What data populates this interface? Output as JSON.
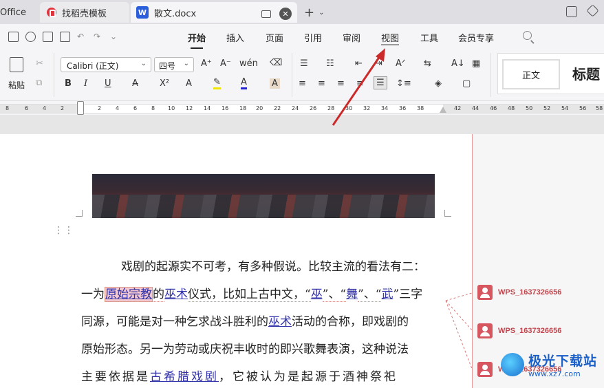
{
  "tabs": {
    "office_label": "Office",
    "docer_label": "找稻壳模板",
    "doc_icon_letter": "W",
    "doc_label": "散文.docx"
  },
  "menu": {
    "items": [
      "开始",
      "插入",
      "页面",
      "引用",
      "审阅",
      "视图",
      "工具",
      "会员专享"
    ],
    "active": "开始"
  },
  "ribbon": {
    "paste_label": "粘贴",
    "font_name": "Calibri (正文)",
    "font_size": "四号",
    "bold": "B",
    "italic": "I",
    "underline": "U",
    "style_normal": "正文",
    "style_title": "标题"
  },
  "ruler": {
    "left_numbers": [
      "8",
      "6",
      "4",
      "2"
    ],
    "right_numbers": [
      "2",
      "4",
      "6",
      "8",
      "10",
      "12",
      "14",
      "16",
      "18",
      "20",
      "22",
      "24",
      "26",
      "28",
      "30",
      "32",
      "34",
      "36",
      "38"
    ],
    "margin_numbers": [
      "42",
      "44",
      "46",
      "48",
      "50",
      "52",
      "54",
      "56",
      "58"
    ]
  },
  "document": {
    "lines": [
      "戏剧的起源实不可考，有多种假说。比较主流的看法有二：",
      "一为原始宗教的巫术仪式，比如上古中文，“巫”、“舞”、“武”三字",
      "同源，可能是对一种乞求战斗胜利的巫术活动的合称，即戏剧的",
      "原始形态。另一为劳动或庆祝丰收时的即兴歌舞表演，这种说法",
      "主要依据是古希腊戏剧，它被认为是起源于酒神祭祀"
    ],
    "line2": {
      "p1": "一为",
      "hl": "原始宗教",
      "p2": "的",
      "l1": "巫术",
      "p3": "仪式，比如上古中文，“",
      "l2": "巫",
      "p4": "”、“",
      "l3": "舞",
      "p5": "”、“",
      "l4": "武",
      "p6": "”三字"
    },
    "line3": {
      "p1": "同源，可能是对一种乞求战斗胜利的",
      "l1": "巫术",
      "p2": "活动的合称，即戏剧的"
    },
    "line5": {
      "p1": "主要依据是",
      "l1": "古希腊戏剧",
      "p2": "，它被认为是起源于酒神祭祀"
    }
  },
  "comments": [
    {
      "author": "WPS_1637326656"
    },
    {
      "author": "WPS_1637326656"
    },
    {
      "author": "WPS_1637326656"
    }
  ],
  "watermark": {
    "title": "极光下载站",
    "url": "www.xz7.com"
  },
  "colors": {
    "accent": "#c0454c",
    "link": "#3333aa",
    "arrow": "#cc2a2a"
  }
}
